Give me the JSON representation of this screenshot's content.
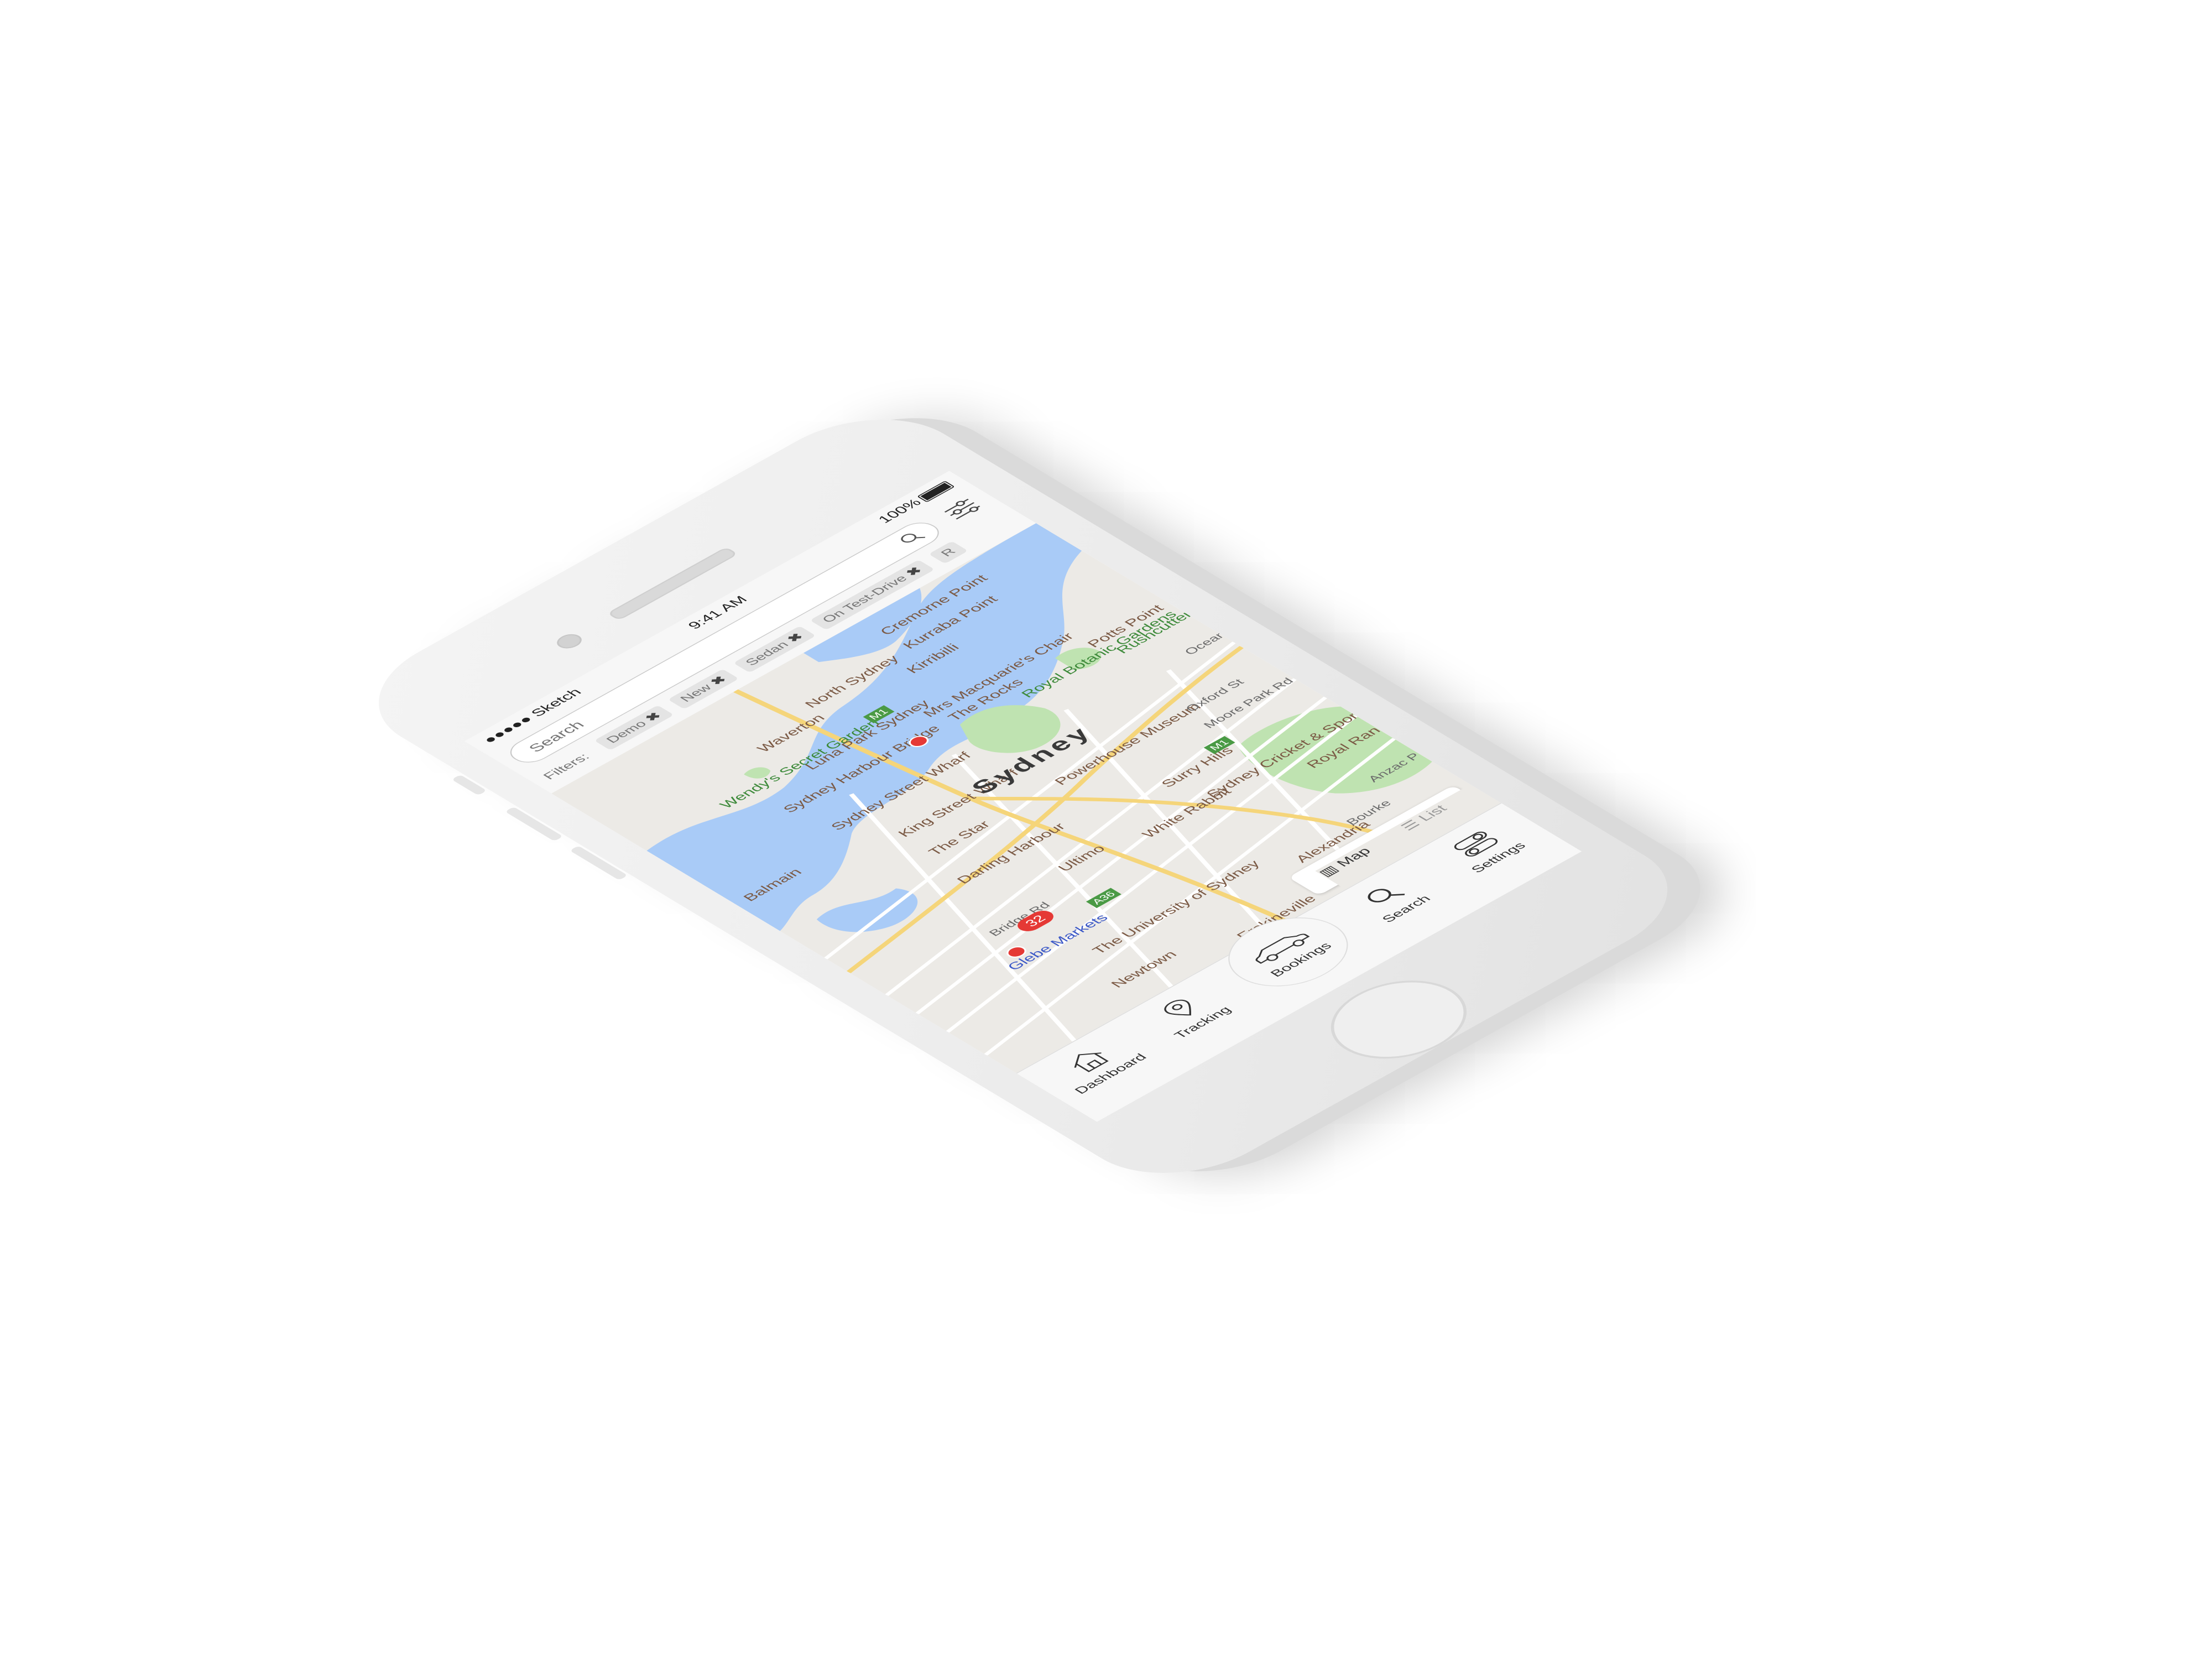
{
  "status_bar": {
    "carrier": "●●●●● Sketch",
    "time": "9:41 AM",
    "battery": "100%"
  },
  "search": {
    "placeholder": "Search"
  },
  "filters": {
    "label": "Filters:",
    "chips": [
      "Demo",
      "New",
      "Sedan",
      "On Test-Drive",
      "R"
    ]
  },
  "map": {
    "city_label": "Sydney",
    "labels": [
      "Cremorne Point",
      "Kurraba Point",
      "North Sydney",
      "Kirribilli",
      "Waverton",
      "Wendy's Secret Garden",
      "Luna Park Sydney",
      "Sydney Harbour Bridge",
      "Mrs Macquarie's Chair",
      "The Rocks",
      "Royal Botanic Gardens",
      "Potts Point",
      "Rushcutters Bay Park",
      "Ocean St",
      "Sydney Street Wharf",
      "King Street Wharf",
      "Balmain",
      "The Star",
      "Powerhouse Museum",
      "Oxford St",
      "Moore Park Rd",
      "Darling Harbour",
      "Surry Hills",
      "Ultimo",
      "White Rabbit",
      "Sydney Cricket & Sports Ground Trust",
      "Royal Randwick Racecourse",
      "Bridge Rd",
      "Glebe Markets",
      "The University of Sydney",
      "Alexandria",
      "Newtown",
      "Erskineville",
      "Anzac P",
      "Bourke"
    ],
    "road_badges": [
      "M1",
      "A36",
      "M1"
    ],
    "cluster_count": "32"
  },
  "view_toggle": {
    "map_label": "Map",
    "list_label": "List"
  },
  "tab_bar": {
    "dashboard": "Dashboard",
    "tracking": "Tracking",
    "bookings": "Bookings",
    "search": "Search",
    "settings": "Settings"
  },
  "colors": {
    "water": "#a9cbf7",
    "park": "#bfe3b1",
    "land": "#eceae6",
    "pin": "#e53935"
  }
}
